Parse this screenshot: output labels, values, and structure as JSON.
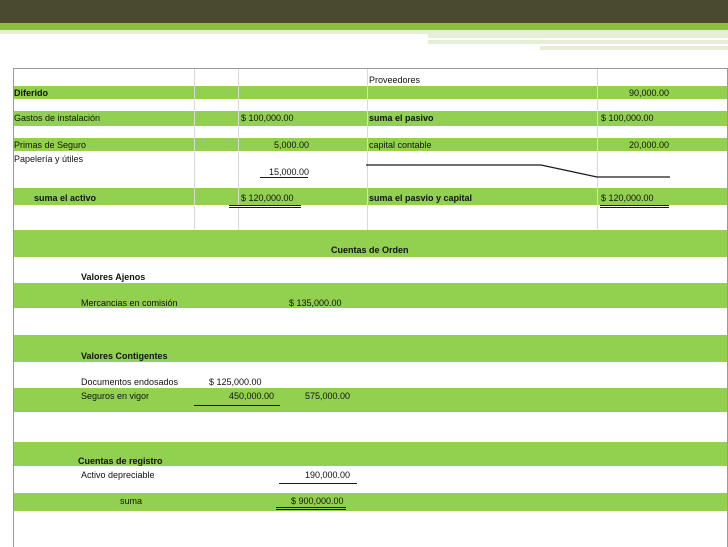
{
  "balance": {
    "diferido": "Diferido",
    "proveedores_label": "Proveedores",
    "proveedores_value": "90,000.00",
    "gastos_label": "Gastos de instalación",
    "gastos_value": "$    100,000.00",
    "suma_pasivo_label": "suma el pasivo",
    "suma_pasivo_value": "$   100,000.00",
    "primas_label": "Primas de Seguro",
    "primas_value": "5,000.00",
    "capital_label": "capital contable",
    "capital_value": "20,000.00",
    "papeleria_label": "Papelería y útiles",
    "papeleria_value": "15,000.00",
    "suma_activo_label": "suma el activo",
    "suma_activo_value": "$   120,000.00",
    "suma_pc_label": "suma el  pasvio y capital",
    "suma_pc_value": "$   120,000.00"
  },
  "orden": {
    "title": "Cuentas de Orden",
    "valores_ajenos": "Valores Ajenos",
    "mercancias_label": "Mercancias en comisión",
    "mercancias_value": "$      135,000.00",
    "valores_contigentes": "Valores Contigentes",
    "documentos_label": "Documentos endosados",
    "documentos_value": "$      125,000.00",
    "seguros_label": "Seguros en vigor",
    "seguros_value": "450,000.00",
    "contigentes_total": "575,000.00",
    "cuentas_registro": "Cuentas de registro",
    "activo_dep_label": "Activo depreciable",
    "activo_dep_value": "190,000.00",
    "suma_label": "suma",
    "suma_value": "$    900,000.00"
  }
}
